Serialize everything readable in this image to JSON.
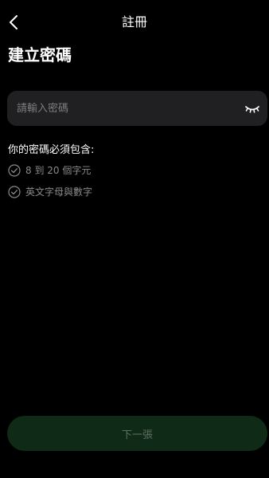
{
  "header": {
    "title": "註冊",
    "back_icon": "chevron-left-icon"
  },
  "page": {
    "title": "建立密碼"
  },
  "password": {
    "placeholder": "請輸入密碼",
    "value": "",
    "toggle_icon": "eye-closed-icon"
  },
  "requirements": {
    "title": "你的密碼必須包含:",
    "items": [
      {
        "label": "8 到 20 個字元",
        "icon": "check-circle-icon",
        "met": false
      },
      {
        "label": "英文字母與數字",
        "icon": "check-circle-icon",
        "met": false
      }
    ]
  },
  "footer": {
    "next_label": "下一張"
  },
  "colors": {
    "background": "#000000",
    "input_bg": "#202022",
    "muted_text": "#8a8a8e",
    "button_bg_disabled": "#0f2a17",
    "button_text_disabled": "#5f6e63"
  }
}
